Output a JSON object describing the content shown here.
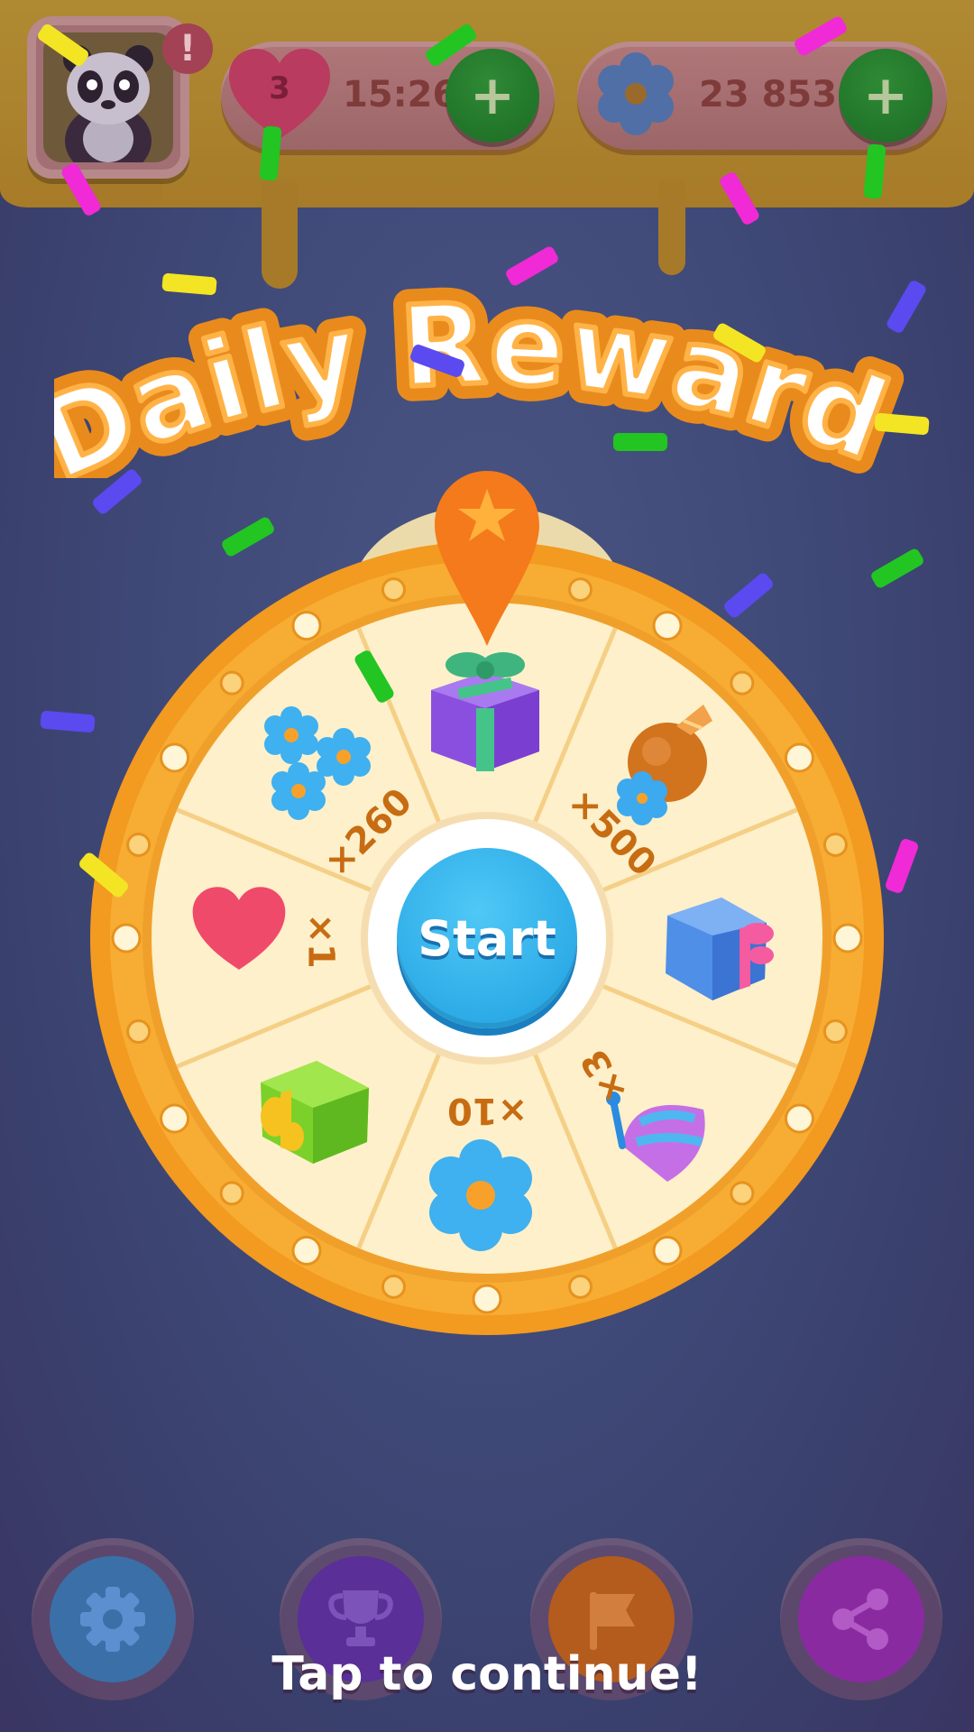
{
  "hud": {
    "lives": {
      "count": "3",
      "timer": "15:26",
      "plus_label": "+"
    },
    "coins": {
      "amount": "23 853",
      "plus_label": "+"
    },
    "profile": {
      "alert_badge": "!"
    }
  },
  "title": "Daily Reward!",
  "wheel": {
    "center_label": "Start",
    "segments": [
      {
        "item": "purple-gift",
        "label": ""
      },
      {
        "item": "coin-bag",
        "label": "×500"
      },
      {
        "item": "blue-gift",
        "label": ""
      },
      {
        "item": "umbrella",
        "label": "×3"
      },
      {
        "item": "flower-coin",
        "label": "×10"
      },
      {
        "item": "green-gift",
        "label": ""
      },
      {
        "item": "heart",
        "label": "×1"
      },
      {
        "item": "flowers",
        "label": "×260"
      }
    ]
  },
  "bottom_nav": {
    "buttons": [
      {
        "icon": "gear-icon"
      },
      {
        "icon": "trophy-icon"
      },
      {
        "icon": "flag-icon"
      },
      {
        "icon": "share-icon"
      }
    ]
  },
  "footer": {
    "tap_label": "Tap to continue!"
  },
  "colors": {
    "background": "#424b7c",
    "honey": "#a97c2a",
    "wheel_rim": "#f4a52b",
    "wheel_face": "#fdefc8",
    "start_button": "#2fb6ee",
    "pointer": "#f47a1c"
  }
}
